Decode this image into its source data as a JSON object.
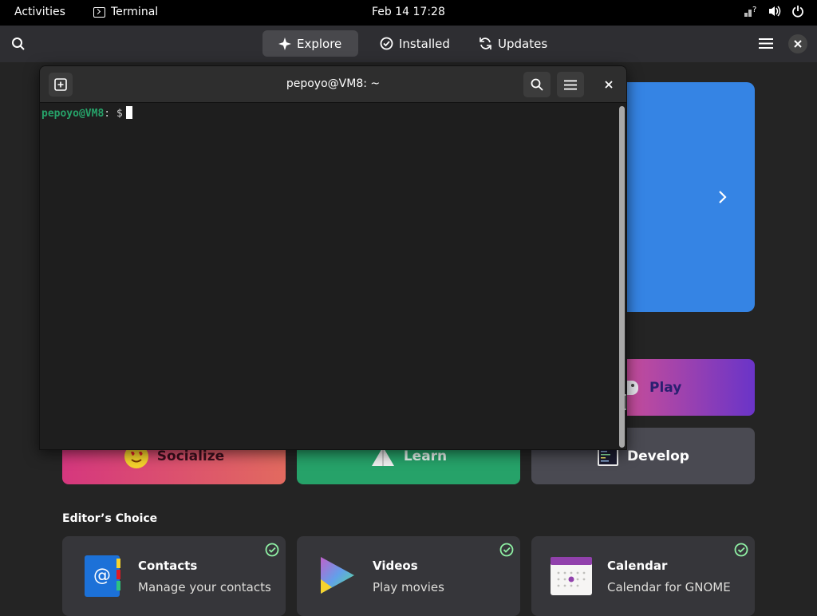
{
  "topbar": {
    "activities": "Activities",
    "app_name": "Terminal",
    "clock": "Feb 14  17:28",
    "tray_icons": [
      "network-question-icon",
      "volume-icon",
      "power-icon"
    ]
  },
  "software": {
    "tabs": [
      {
        "label": "Explore",
        "icon": "sparkle-icon",
        "active": true
      },
      {
        "label": "Installed",
        "icon": "check-circle-icon",
        "active": false
      },
      {
        "label": "Updates",
        "icon": "refresh-icon",
        "active": false
      }
    ],
    "categories": {
      "play": "Play",
      "socialize": "Socialize",
      "learn": "Learn",
      "develop": "Develop"
    },
    "editors_choice": "Editor’s Choice",
    "apps": [
      {
        "name": "Contacts",
        "description": "Manage your contacts"
      },
      {
        "name": "Videos",
        "description": "Play movies"
      },
      {
        "name": "Calendar",
        "description": "Calendar for GNOME"
      }
    ],
    "colors": {
      "banner": "#3584e4",
      "learn": "#26a269",
      "installed_check": "#8ff0a4"
    }
  },
  "terminal": {
    "title": "pepoyo@VM8: ~",
    "prompt_user": "pepoyo@VM8",
    "prompt_sep": ": $",
    "prompt_color": "#26a269"
  }
}
